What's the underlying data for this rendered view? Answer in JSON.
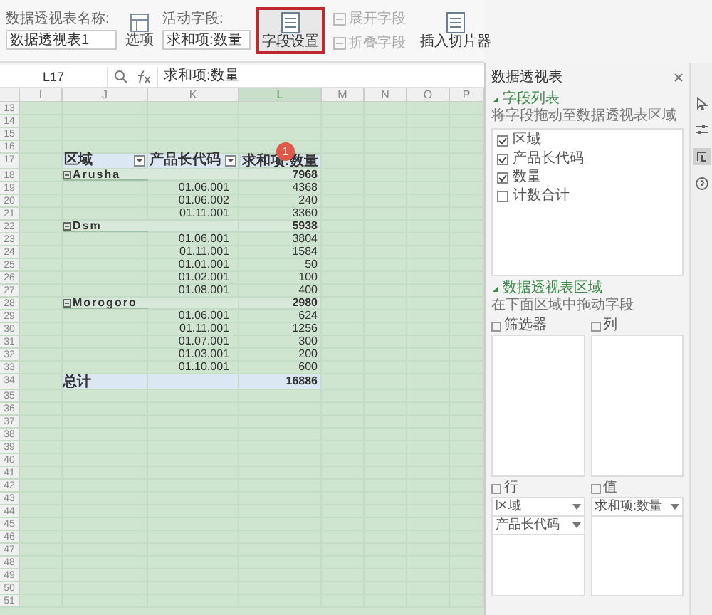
{
  "ribbon": {
    "pivot_name": {
      "label": "数据透视表名称:",
      "value": "数据透视表1"
    },
    "options_button": "选项",
    "active_field": {
      "label": "活动字段:",
      "value": "求和项:数量"
    },
    "buttons": [
      {
        "label": "字段设置",
        "kind": "large",
        "highlighted": true,
        "disabled": false
      },
      {
        "label": "展开字段",
        "kind": "small",
        "highlighted": false,
        "disabled": true
      },
      {
        "label": "折叠字段",
        "kind": "small",
        "highlighted": false,
        "disabled": true
      },
      {
        "label": "插入切片器",
        "kind": "large",
        "highlighted": false,
        "disabled": false
      }
    ]
  },
  "formula_bar": {
    "cell": "L17",
    "formula": "求和项:数量"
  },
  "sheet": {
    "columns": [
      {
        "label": "I",
        "selected": false
      },
      {
        "label": "J",
        "selected": false
      },
      {
        "label": "K",
        "selected": false
      },
      {
        "label": "L",
        "selected": true
      },
      {
        "label": "M",
        "selected": false
      },
      {
        "label": "N",
        "selected": false
      },
      {
        "label": "O",
        "selected": false
      },
      {
        "label": "P",
        "selected": false
      }
    ],
    "row_numbers": [
      "13",
      "14",
      "15",
      "16",
      "17",
      "18",
      "19",
      "20",
      "21",
      "22",
      "23",
      "24",
      "25",
      "26",
      "27",
      "28",
      "29",
      "30",
      "31",
      "32",
      "33",
      "34",
      "35",
      "36",
      "37",
      "38",
      "39",
      "40",
      "41",
      "42",
      "43",
      "44",
      "45",
      "46",
      "47",
      "48",
      "49",
      "50",
      "51"
    ],
    "pivot": {
      "headers": [
        "区域",
        "产品长代码",
        "求和项:数量"
      ],
      "groups": [
        {
          "name": "Arusha",
          "total": "7968",
          "items": [
            {
              "code": "01.06.001",
              "value": "4368"
            },
            {
              "code": "01.06.002",
              "value": "240"
            },
            {
              "code": "01.11.001",
              "value": "3360"
            }
          ]
        },
        {
          "name": "Dsm",
          "total": "5938",
          "items": [
            {
              "code": "01.06.001",
              "value": "3804"
            },
            {
              "code": "01.11.001",
              "value": "1584"
            },
            {
              "code": "01.01.001",
              "value": "50"
            },
            {
              "code": "01.02.001",
              "value": "100"
            },
            {
              "code": "01.08.001",
              "value": "400"
            }
          ]
        },
        {
          "name": "Morogoro",
          "total": "2980",
          "items": [
            {
              "code": "01.06.001",
              "value": "624"
            },
            {
              "code": "01.11.001",
              "value": "1256"
            },
            {
              "code": "01.07.001",
              "value": "300"
            },
            {
              "code": "01.03.001",
              "value": "200"
            },
            {
              "code": "01.10.001",
              "value": "600"
            }
          ]
        }
      ],
      "grand_total": {
        "label": "总计",
        "value": "16886"
      },
      "annotation_badge": "1"
    }
  },
  "panel": {
    "title": "数据透视表",
    "field_list": {
      "heading": "字段列表",
      "hint": "将字段拖动至数据透视表区域",
      "fields": [
        {
          "label": "区域",
          "checked": true
        },
        {
          "label": "产品长代码",
          "checked": true
        },
        {
          "label": "数量",
          "checked": true
        },
        {
          "label": "计数合计",
          "checked": false
        }
      ]
    },
    "areas": {
      "heading": "数据透视表区域",
      "hint": "在下面区域中拖动字段",
      "filters": {
        "label": "筛选器"
      },
      "columns": {
        "label": "列"
      },
      "rows": {
        "label": "行",
        "items": [
          "区域",
          "产品长代码"
        ]
      },
      "values": {
        "label": "值",
        "items": [
          "求和项:数量"
        ]
      }
    }
  }
}
